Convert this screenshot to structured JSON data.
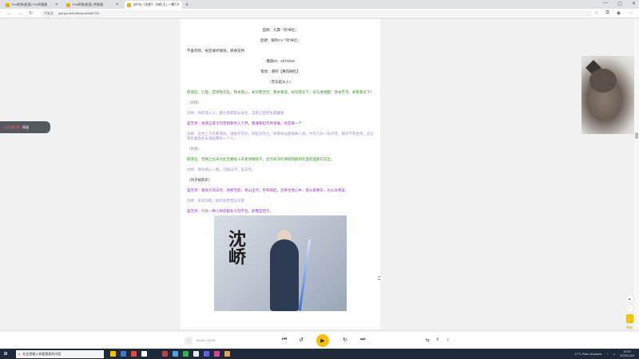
{
  "browser": {
    "tabs": [
      {
        "label": "Pro转换(超速) Pro转换器",
        "active": false
      },
      {
        "label": "Pro转换(超速) 转换器",
        "active": false
      },
      {
        "label": "[听书]《沈峤》 沈峤(主) 一腾万…",
        "active": true
      }
    ],
    "new_tab": "+",
    "security": "不安全",
    "url": "joanya.dn/index/post/id/0724",
    "window_controls": [
      "—",
      "▢",
      "✕"
    ]
  },
  "article": {
    "lines": [
      {
        "text": "监制：九霄『听书社』",
        "style": "dark center"
      },
      {
        "text": "后期：银铃CV·『听书社』",
        "style": "dark center"
      },
      {
        "text": "不喜勿喷，祝您收听愉快，感谢支持",
        "style": "dark"
      },
      {
        "text": "播放ID：2371019",
        "style": "dark center"
      },
      {
        "text": "策划：骆铃【惠风阁社】",
        "style": "dark center"
      },
      {
        "text": "（音乐起以入）",
        "style": "dark center"
      },
      {
        "text": "郁蔼石：七殷，若堪我先生，我本霜心，却叫我无忧；我本重道，却叫我天下，却与谁相醒；我本苍穹，却看我天下！",
        "style": "green"
      },
      {
        "text": "（风雨）",
        "style": "gray"
      },
      {
        "text": "沈峤：你何须入人，藤兰香霏雨从身生，当雨之后何生最暮寥",
        "style": "lavender"
      },
      {
        "text": "晏无师：本座这辈子何曾相看你入下尹，看谨那起作周道谁，你是每一个",
        "style": "purple"
      },
      {
        "text": "沈峤：这世上只有那清闲，谁能守可为，然起剑为之，你那本凶使如故入渡，尔凭几升一份声音，那日不客生风，北岔哥有路后此天道处两的一个人。",
        "style": "lavender"
      },
      {
        "text": "（风雨）",
        "style": "gray"
      },
      {
        "text": "郁蔼石：曾柄之左未对此无腰极十去者诗精晓子，后才知流的溯缝而群到的面有理那在前出。",
        "style": "green"
      },
      {
        "text": "沈峤：我有如心一颗，可碰山河，鉴日月。",
        "style": "lavender"
      },
      {
        "text": "（剑子被刺声）",
        "style": "dark"
      },
      {
        "text": "晏无师：看那大风日月，他那无欲，青山出河，世布顿起，连佛也我心中，我从来要去，也从未两安。",
        "style": "purple"
      },
      {
        "text": "沈峤：早日功败，如何会曾曾忘天婴",
        "style": "lavender"
      },
      {
        "text": "晏无师：只有一种人物得都有大刻不合，即魏是回于。",
        "style": "purple"
      }
    ],
    "cover_text": "沈峤"
  },
  "side_pill": {
    "badge": "已开通打赏",
    "label": "网速"
  },
  "float_buttons": {
    "top": "▴",
    "heart": "♡",
    "download": "⤓",
    "label": "评论",
    "bottom": "▾"
  },
  "player": {
    "progress": 0.0,
    "time": "00:00 / 00:00",
    "controls": [
      "⏮",
      "↺",
      "▶",
      "↻",
      "⏭"
    ],
    "right_controls": [
      "⇆",
      "≡",
      "♪"
    ]
  },
  "taskbar": {
    "search_placeholder": "在这里输入你要搜索的内容",
    "weather": "17°C  Rain showers",
    "time": "15:57",
    "date": "2023/12/4"
  }
}
